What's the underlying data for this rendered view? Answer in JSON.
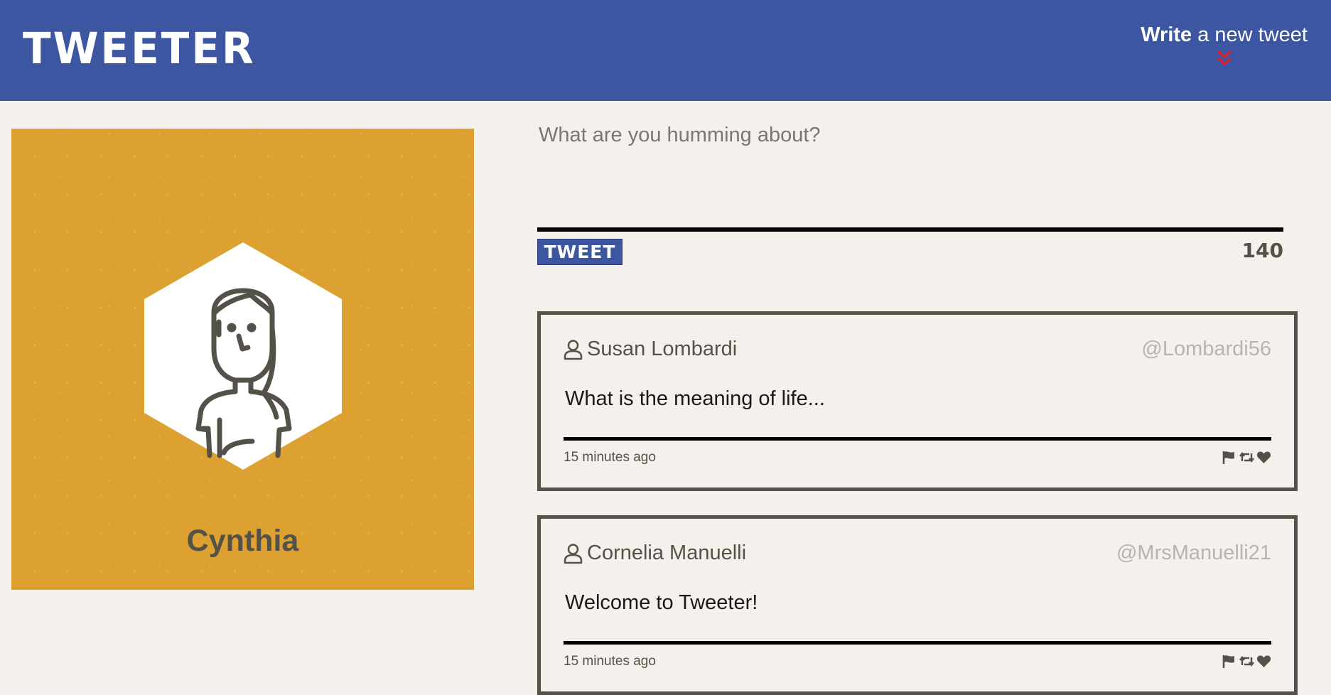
{
  "nav": {
    "brand": "TWEETER",
    "compose_bold": "Write",
    "compose_rest": " a new tweet",
    "chevron_icon": "double-chevron-down-icon",
    "accent_color": "#e0202d"
  },
  "profile": {
    "name": "Cynthia",
    "avatar_icon": "woman-avatar-icon",
    "background_color": "#dca130"
  },
  "composer": {
    "placeholder": "What are you humming about?",
    "button_label": "TWEET",
    "counter": "140"
  },
  "tweets": [
    {
      "name": "Susan Lombardi",
      "handle": "@Lombardi56",
      "body": "What is the meaning of life...",
      "time": "15 minutes ago",
      "icons": [
        "flag-icon",
        "retweet-icon",
        "heart-icon"
      ]
    },
    {
      "name": "Cornelia Manuelli",
      "handle": "@MrsManuelli21",
      "body": "Welcome to Tweeter!",
      "time": "15 minutes ago",
      "icons": [
        "flag-icon",
        "retweet-icon",
        "heart-icon"
      ]
    }
  ],
  "colors": {
    "nav": "#3d56a1",
    "page": "#f4f1ec",
    "text": "#545149",
    "handle": "#b7b5b0"
  }
}
